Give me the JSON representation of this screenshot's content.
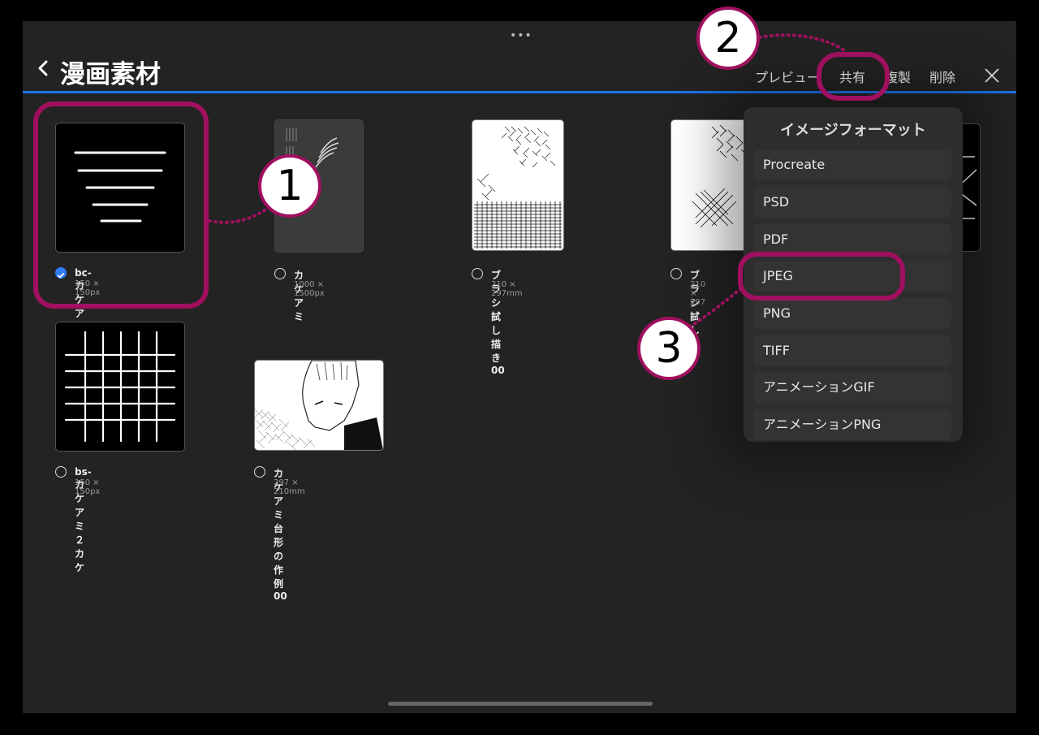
{
  "header": {
    "title": "漫画素材",
    "preview_label": "プレビュー",
    "share_label": "共有",
    "duplicate_label": "複製",
    "delete_label": "削除"
  },
  "gallery": {
    "items": [
      {
        "name": "bc-カケアミ台形",
        "size": "150 × 150px",
        "selected": true
      },
      {
        "name": "カケアミ",
        "size": "1000 × 1500px",
        "selected": false
      },
      {
        "name": "ブラシ試し描き00",
        "size": "210 × 297mm",
        "selected": false
      },
      {
        "name": "ブラシ試し",
        "size": "210 × 297",
        "selected": false
      },
      {
        "name": "bs-カケアミ２カケ",
        "size": "150 × 150px",
        "selected": false
      },
      {
        "name": "カケアミ台形の作例00",
        "size": "297 × 210mm",
        "selected": false
      }
    ]
  },
  "export_menu": {
    "title": "イメージフォーマット",
    "options": [
      "Procreate",
      "PSD",
      "PDF",
      "JPEG",
      "PNG",
      "TIFF",
      "アニメーションGIF",
      "アニメーションPNG"
    ]
  },
  "annotations": {
    "step1": "1",
    "step2": "2",
    "step3": "3",
    "color": "#a0105f"
  },
  "colors": {
    "accent_blue": "#1a73e8",
    "background": "#232323"
  }
}
